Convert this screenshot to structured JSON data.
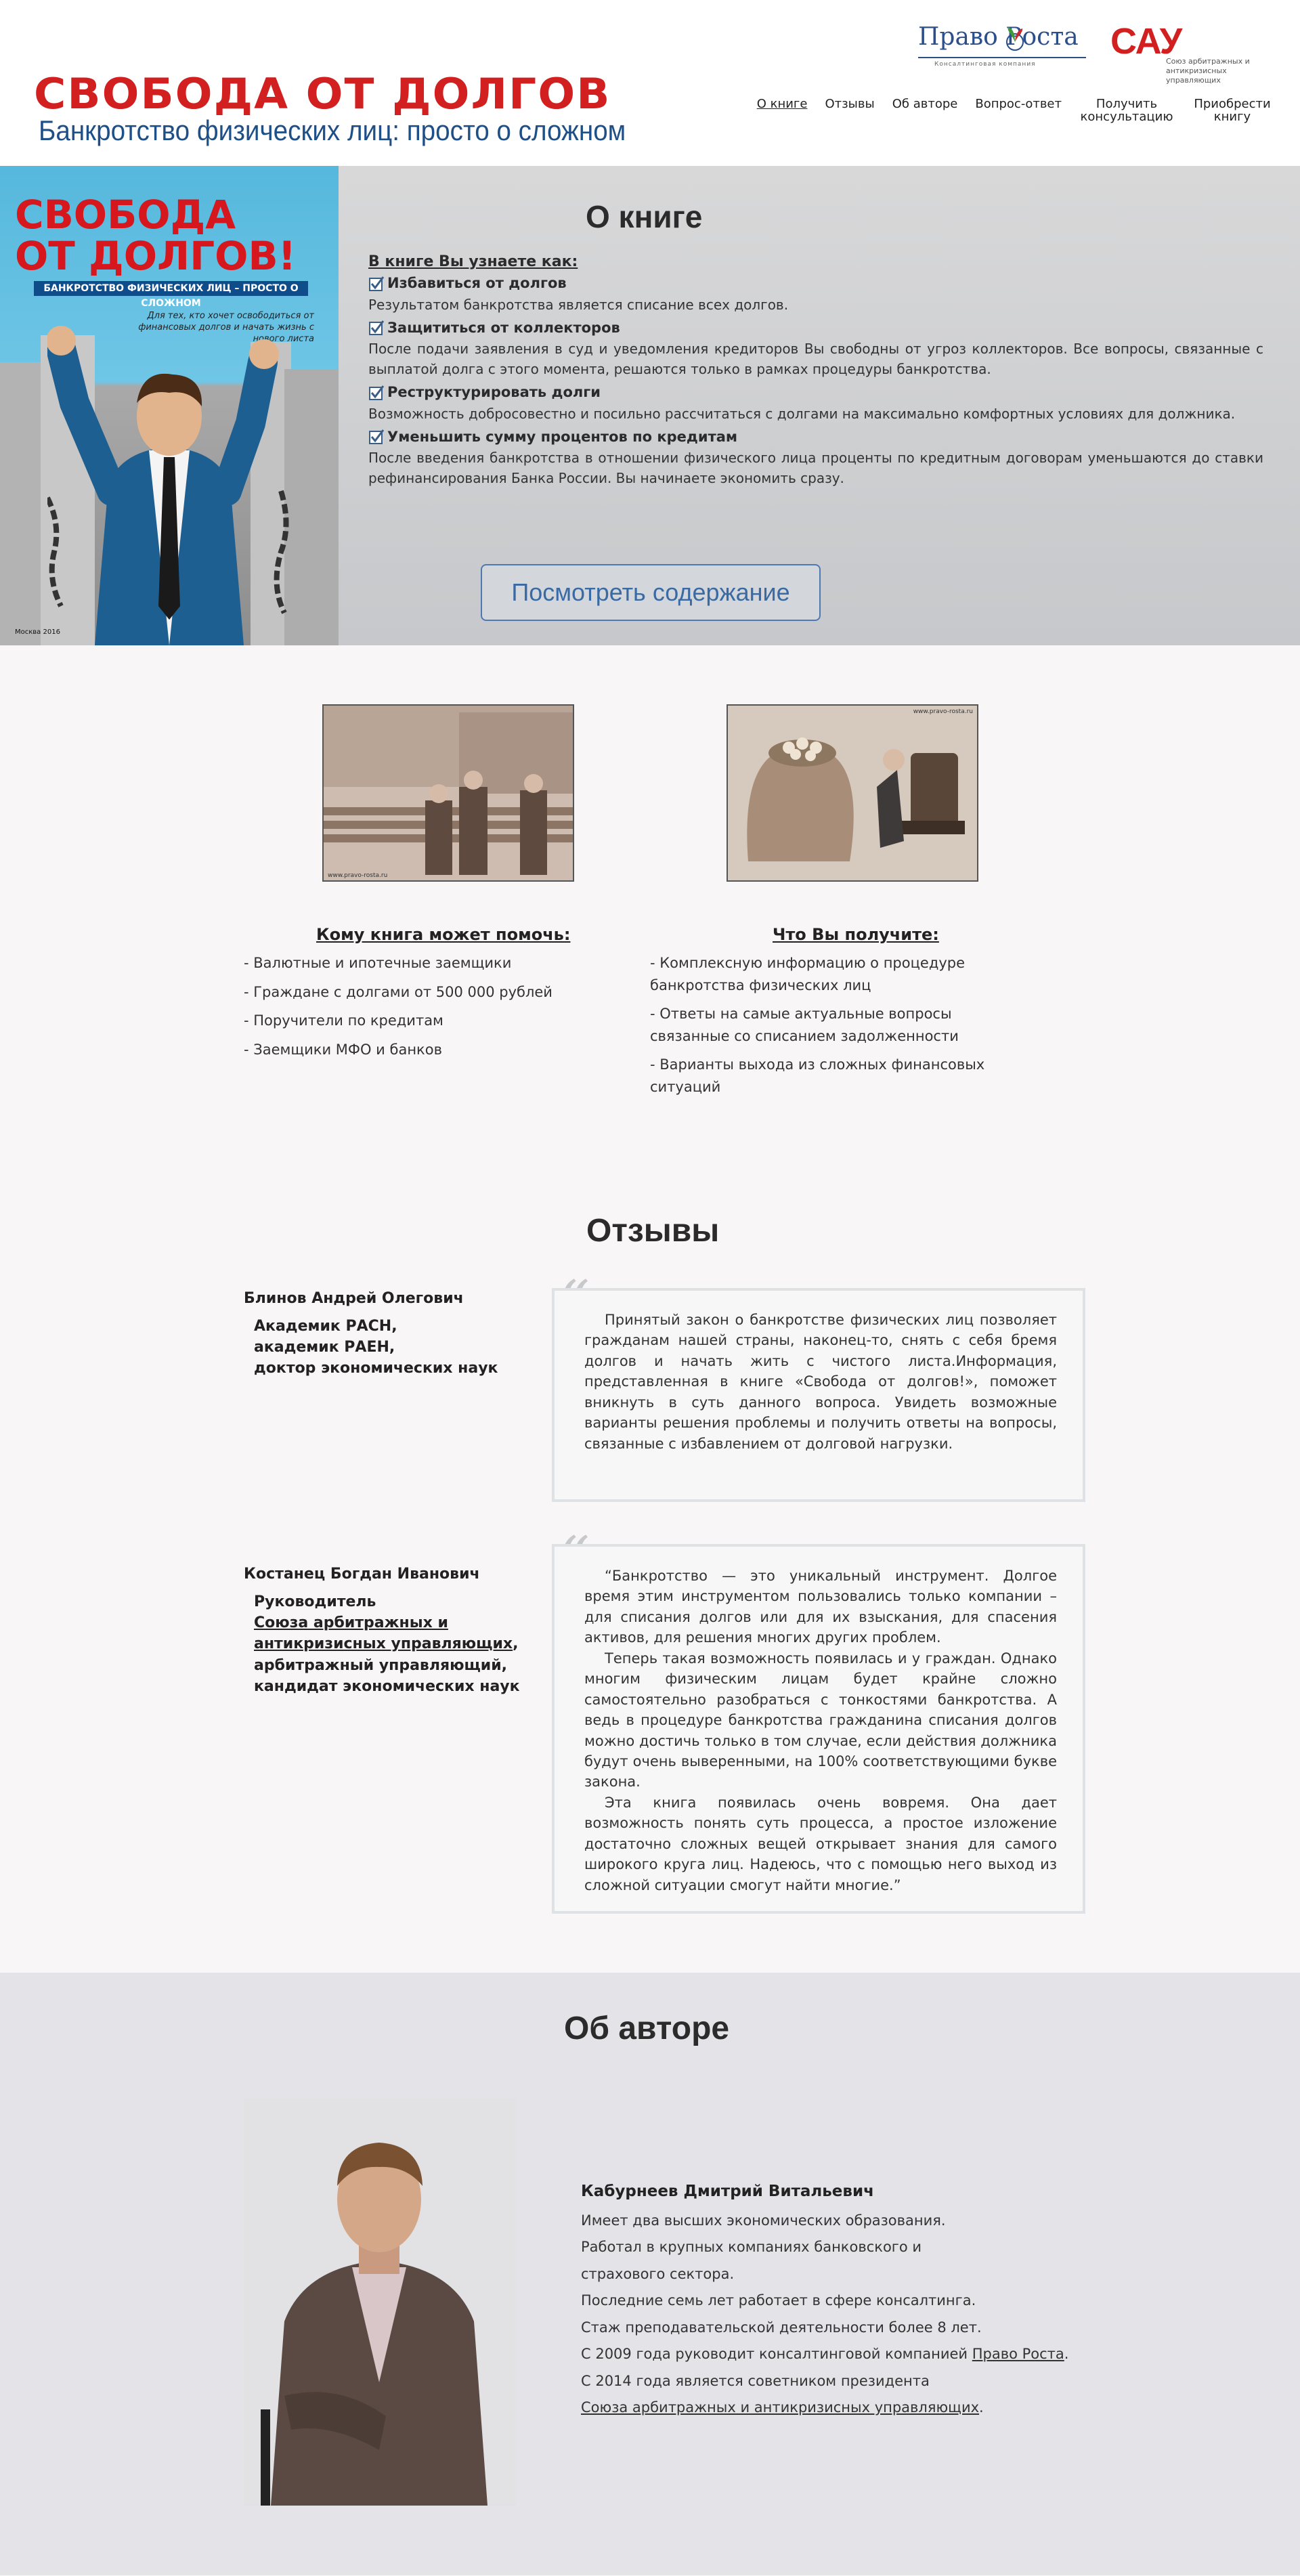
{
  "header": {
    "title": "СВОБОДА ОТ ДОЛГОВ",
    "subtitle": "Банкротство физических лиц: просто о сложном",
    "partner1": {
      "name": "Право Роста",
      "tag": "Консалтинговая компания"
    },
    "partner2": {
      "name": "САУ",
      "tag": "Союз арбитражных и антикризисных управляющих"
    },
    "nav": [
      "О книге",
      "Отзывы",
      "Об авторе",
      "Вопрос-ответ",
      "Получить консультацию",
      "Приобрести книгу"
    ]
  },
  "cover": {
    "title_line1": "СВОБОДА",
    "title_line2": "ОТ ДОЛГОВ!",
    "band": "БАНКРОТСТВО ФИЗИЧЕСКИХ ЛИЦ – ПРОСТО О СЛОЖНОМ",
    "note": "Для тех, кто хочет освободиться от финансовых долгов и начать жизнь с нового листа",
    "year": "Москва 2016"
  },
  "about": {
    "title": "О книге",
    "learn_heading": "В книге Вы узнаете как:",
    "benefits": [
      {
        "title": "Избавиться от долгов",
        "text": "Результатом банкротства является списание всех долгов."
      },
      {
        "title": "Защититься от коллекторов",
        "text": "После подачи заявления в суд и уведомления кредиторов Вы свободны от угроз коллекторов. Все вопросы, связанные с выплатой долга с этого момента, решаются только в рамках процедуры банкротства."
      },
      {
        "title": "Реструктурировать долги",
        "text": "Возможность добросовестно и посильно рассчитаться с долгами на максимально комфортных условиях для должника."
      },
      {
        "title": "Уменьшить сумму процентов по кредитам",
        "text": "После введения банкротства в отношении физического лица проценты по кредитным договорам уменьшаются до ставки рефинансирования Банка России. Вы начинаете экономить сразу."
      }
    ],
    "button": "Посмотреть содержание"
  },
  "who": {
    "title": "Кому книга может помочь:",
    "items": [
      "- Валютные и ипотечные заемщики",
      "- Граждане с долгами от 500 000 рублей",
      "- Поручители по кредитам",
      "- Заемщики МФО и банков"
    ],
    "image_caption": "www.pravo-rosta.ru"
  },
  "what": {
    "title": "Что Вы получите:",
    "items": [
      "- Комплексную информацию о процедуре банкротства физических лиц",
      "- Ответы на самые актуальные вопросы связанные со списанием задолженности",
      "- Варианты выхода из сложных финансовых ситуаций"
    ],
    "image_caption": "www.pravo-rosta.ru"
  },
  "reviews": {
    "title": "Отзывы",
    "items": [
      {
        "name": "Блинов Андрей Олегович",
        "position": [
          "Академик РАСН,",
          "академик РАЕН,",
          "доктор экономических наук"
        ],
        "text": [
          "Принятый закон о банкротстве физических лиц позволяет гражданам нашей страны, наконец-то, снять с себя бремя долгов и начать жить с чистого листа.Информация, представленная в книге «Свобода от долгов!», поможет вникнуть в суть данного вопроса. Увидеть возможные варианты решения проблемы и получить ответы на вопросы, связанные с избавлением от долговой нагрузки."
        ]
      },
      {
        "name": "Костанец Богдан Иванович",
        "position_lead": "Руководитель",
        "position_link": "Союза арбитражных и антикризисных управляющих",
        "position_rest": [
          "арбитражный управляющий,",
          "кандидат экономических наук"
        ],
        "text": [
          "“Банкротство — это уникальный инструмент. Долгое время этим инструментом пользовались только компании – для списания долгов или для их взыскания, для спасения активов, для решения многих других проблем.",
          "Теперь такая возможность появилась и у граждан. Однако многим физическим лицам будет крайне сложно самостоятельно разобраться с тонкостями банкротства.  А ведь в процедуре банкротства гражданина списания долгов можно достичь только в том случае, если действия должника будут очень выверенными, на 100% соответствующими букве закона.",
          "Эта книга появилась очень вовремя. Она дает возможность понять суть процесса, а простое изложение достаточно сложных вещей открывает знания для самого широкого круга лиц. Надеюсь, что с помощью него выход из сложной ситуации смогут найти многие.”"
        ]
      }
    ]
  },
  "author": {
    "title": "Об авторе",
    "name": "Кабурнеев Дмитрий Витальевич",
    "bio": [
      "Имеет два высших экономических образования.",
      "Работал в крупных компаниях банковского и",
      "страхового сектора.",
      "Последние семь лет работает в сфере консалтинга.",
      "Стаж преподавательской деятельности более 8 лет."
    ],
    "bio_2009_pre": "С 2009 года руководит консалтинговой компанией ",
    "bio_2009_link": "Право Роста",
    "bio_2009_post": ".",
    "bio_2014": "С 2014 года является советником президента",
    "bio_2014_link": "Союза арбитражных и антикризисных управляющих",
    "bio_2014_post": "."
  },
  "colors": {
    "brand_red": "#d21f1f",
    "brand_blue": "#1f4f87",
    "button_blue": "#3a6aa3"
  }
}
